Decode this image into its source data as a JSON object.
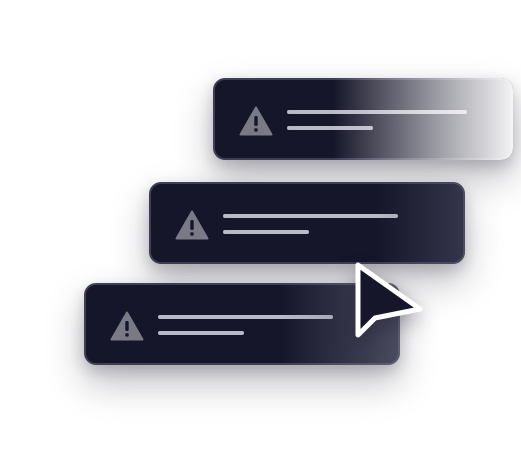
{
  "scene": {
    "description_label": "",
    "colors": {
      "card_background": "#16162a",
      "card_border": "#3e3e55",
      "line": "#b9b9c8",
      "warning_icon": "#7a7a86",
      "cursor_fill": "#16162a",
      "cursor_stroke": "#ffffff"
    }
  },
  "cards": [
    {
      "icon": "warning-triangle-icon"
    },
    {
      "icon": "warning-triangle-icon"
    },
    {
      "icon": "warning-triangle-icon"
    }
  ],
  "cursor": {
    "icon": "pointer-cursor-icon"
  }
}
